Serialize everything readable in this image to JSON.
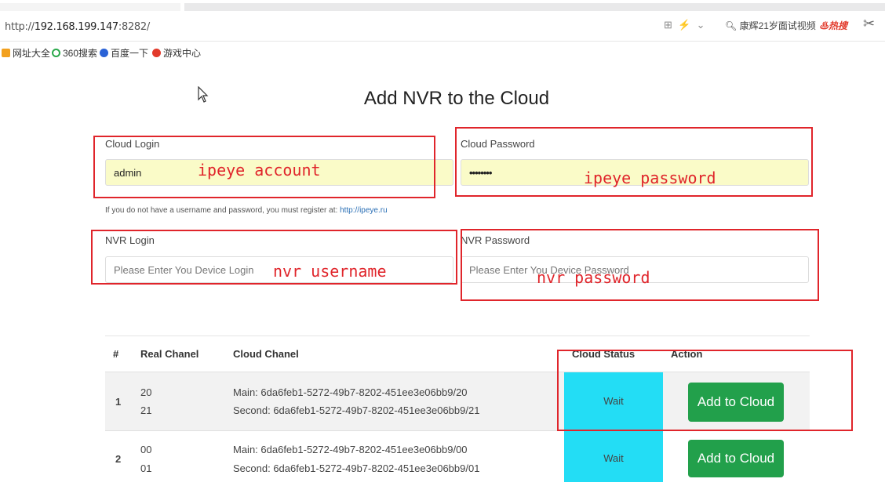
{
  "browser": {
    "url_scheme": "http://",
    "url_host": "192.168.199.147",
    "url_port": ":8282/",
    "search_text": "康辉21岁面试视频",
    "hot_label": "热搜",
    "bookmarks": [
      {
        "label": "网址大全",
        "color": "#f2a01e"
      },
      {
        "label": "360搜索",
        "color": "#2aa84a"
      },
      {
        "label": "百度一下",
        "color": "#2a62d6"
      },
      {
        "label": "游戏中心",
        "color": "#e23a2b"
      }
    ]
  },
  "page": {
    "title": "Add NVR to the Cloud"
  },
  "form": {
    "cloud_login": {
      "label": "Cloud Login",
      "value": "admin",
      "annotation": "ipeye account"
    },
    "cloud_password": {
      "label": "Cloud Password",
      "value": "••••••••",
      "annotation": "ipeye password"
    },
    "hint_text": "If you do not have a username and password, you must register at: ",
    "hint_link": "http://ipeye.ru",
    "nvr_login": {
      "label": "NVR Login",
      "placeholder": "Please Enter You Device Login",
      "annotation": "nvr username"
    },
    "nvr_password": {
      "label": "NVR Password",
      "placeholder": "Please Enter You Device Password",
      "annotation": "nvr password"
    }
  },
  "table": {
    "headers": [
      "#",
      "Real Chanel",
      "Cloud Chanel",
      "Cloud Status",
      "Action"
    ],
    "rows": [
      {
        "num": "1",
        "real": [
          "20",
          "21"
        ],
        "cloud": [
          "Main: 6da6feb1-5272-49b7-8202-451ee3e06bb9/20",
          "Second: 6da6feb1-5272-49b7-8202-451ee3e06bb9/21"
        ],
        "status": "Wait",
        "action": "Add to Cloud"
      },
      {
        "num": "2",
        "real": [
          "00",
          "01"
        ],
        "cloud": [
          "Main: 6da6feb1-5272-49b7-8202-451ee3e06bb9/00",
          "Second: 6da6feb1-5272-49b7-8202-451ee3e06bb9/01"
        ],
        "status": "Wait",
        "action": "Add to Cloud"
      }
    ]
  },
  "colors": {
    "annotation_red": "#e0252b",
    "status_cyan": "#23ddf5",
    "button_green": "#22a04b",
    "autofill_yellow": "#fafbc8"
  }
}
